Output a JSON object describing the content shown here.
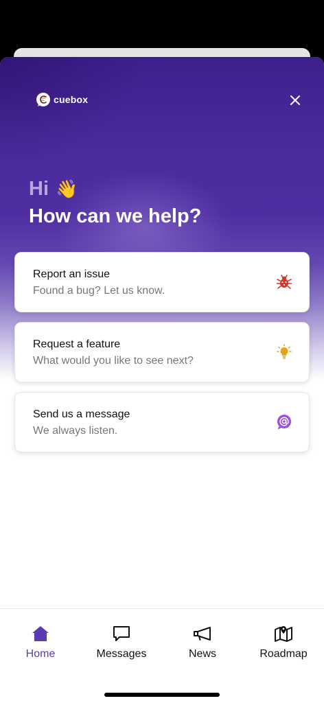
{
  "brand": {
    "name": "cuebox",
    "primary_color": "#4a2a9c",
    "accent_color": "#f5a623"
  },
  "header": {
    "greeting": "Hi",
    "greeting_emoji": "👋",
    "headline": "How can we help?"
  },
  "cards": [
    {
      "title": "Report an issue",
      "subtitle": "Found a bug? Let us know.",
      "icon": "bug-icon",
      "icon_color": "#d0342c"
    },
    {
      "title": "Request a feature",
      "subtitle": "What would you like to see next?",
      "icon": "lightbulb-icon",
      "icon_color": "#e8a317"
    },
    {
      "title": "Send us a message",
      "subtitle": "We always listen.",
      "icon": "at-sign-icon",
      "icon_color": "#9b4fe0"
    }
  ],
  "tabs": [
    {
      "label": "Home",
      "icon": "home-icon",
      "active": true
    },
    {
      "label": "Messages",
      "icon": "message-icon",
      "active": false
    },
    {
      "label": "News",
      "icon": "megaphone-icon",
      "active": false
    },
    {
      "label": "Roadmap",
      "icon": "map-icon",
      "active": false
    }
  ]
}
